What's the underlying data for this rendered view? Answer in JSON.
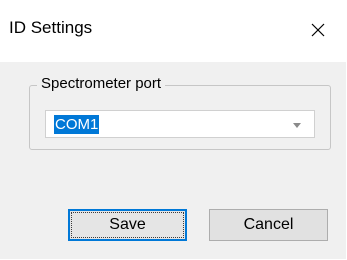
{
  "window": {
    "title": "ID Settings",
    "close_icon": "close-icon"
  },
  "port_group": {
    "legend": "Spectrometer port",
    "combo": {
      "selected_value": "COM1",
      "arrow_icon": "chevron-down-icon"
    }
  },
  "buttons": {
    "save_label": "Save",
    "cancel_label": "Cancel"
  },
  "colors": {
    "selection": "#0078d7",
    "dialog_background": "#f0f0f0"
  }
}
